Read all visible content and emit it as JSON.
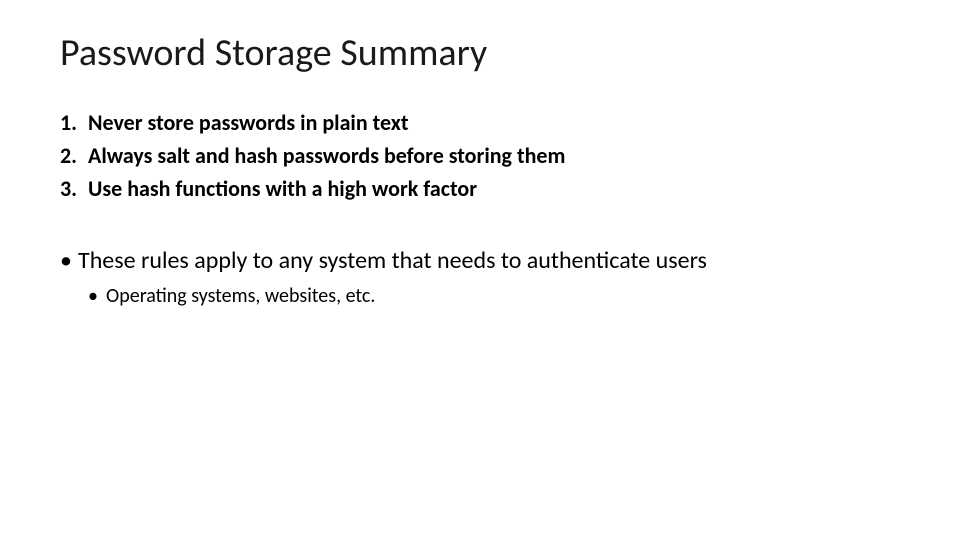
{
  "title": "Password Storage Summary",
  "rules": [
    "Never store passwords in plain text",
    "Always salt and hash passwords before storing them",
    "Use hash functions with a high work factor"
  ],
  "notes": {
    "main": "These rules apply to any system that needs to authenticate users",
    "sub": "Operating systems, websites, etc."
  }
}
